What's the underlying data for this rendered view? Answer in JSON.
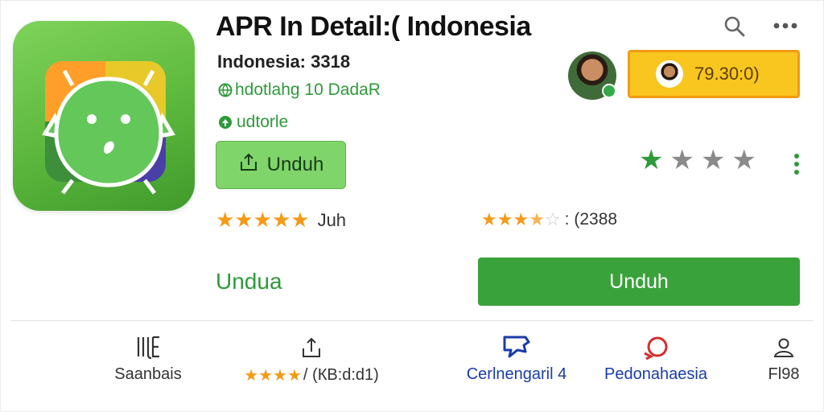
{
  "app": {
    "title": "APR In Detail:( Indonesia",
    "subtitle": "Indonesia: 3318",
    "meta": "hdotlahg 10 DadaR",
    "developer": "udtorle",
    "small_button_label": "Unduh"
  },
  "header_icons": [
    "search-icon",
    "more-horiz-icon"
  ],
  "price_button": {
    "label": "79.30:0)"
  },
  "rating_right": {
    "filled": 1,
    "total": 4,
    "colors": {
      "filled": "#2e9a3a",
      "empty": "#8a8a8a"
    }
  },
  "ratings": {
    "row1": {
      "stars": 5,
      "label": "Juh"
    },
    "row2": {
      "stars": 3.5,
      "label": ": (2388"
    }
  },
  "actions": {
    "link_label": "Undua",
    "install_label": "Unduh"
  },
  "bottom_nav": [
    {
      "id": "ul",
      "icon": "list-icon",
      "label": "Saanbais",
      "color": "#333333"
    },
    {
      "id": "rate",
      "icon": "download-icon",
      "stars": 4,
      "label": "/ (КВ:d:d1)",
      "color": "#333333"
    },
    {
      "id": "share",
      "icon": "chat-bubble-icon",
      "label": "Cerlnengaril 4",
      "color": "#1a3da8"
    },
    {
      "id": "pedoman",
      "icon": "refresh-icon",
      "label": "Pedonahaesia",
      "color": "#1a3da8"
    },
    {
      "id": "profile",
      "icon": "person-icon",
      "label": "Fl98",
      "color": "#333333"
    }
  ],
  "colors": {
    "accent_green": "#3aa23a",
    "price_yellow": "#f9c61f",
    "star_orange": "#f59a17"
  }
}
